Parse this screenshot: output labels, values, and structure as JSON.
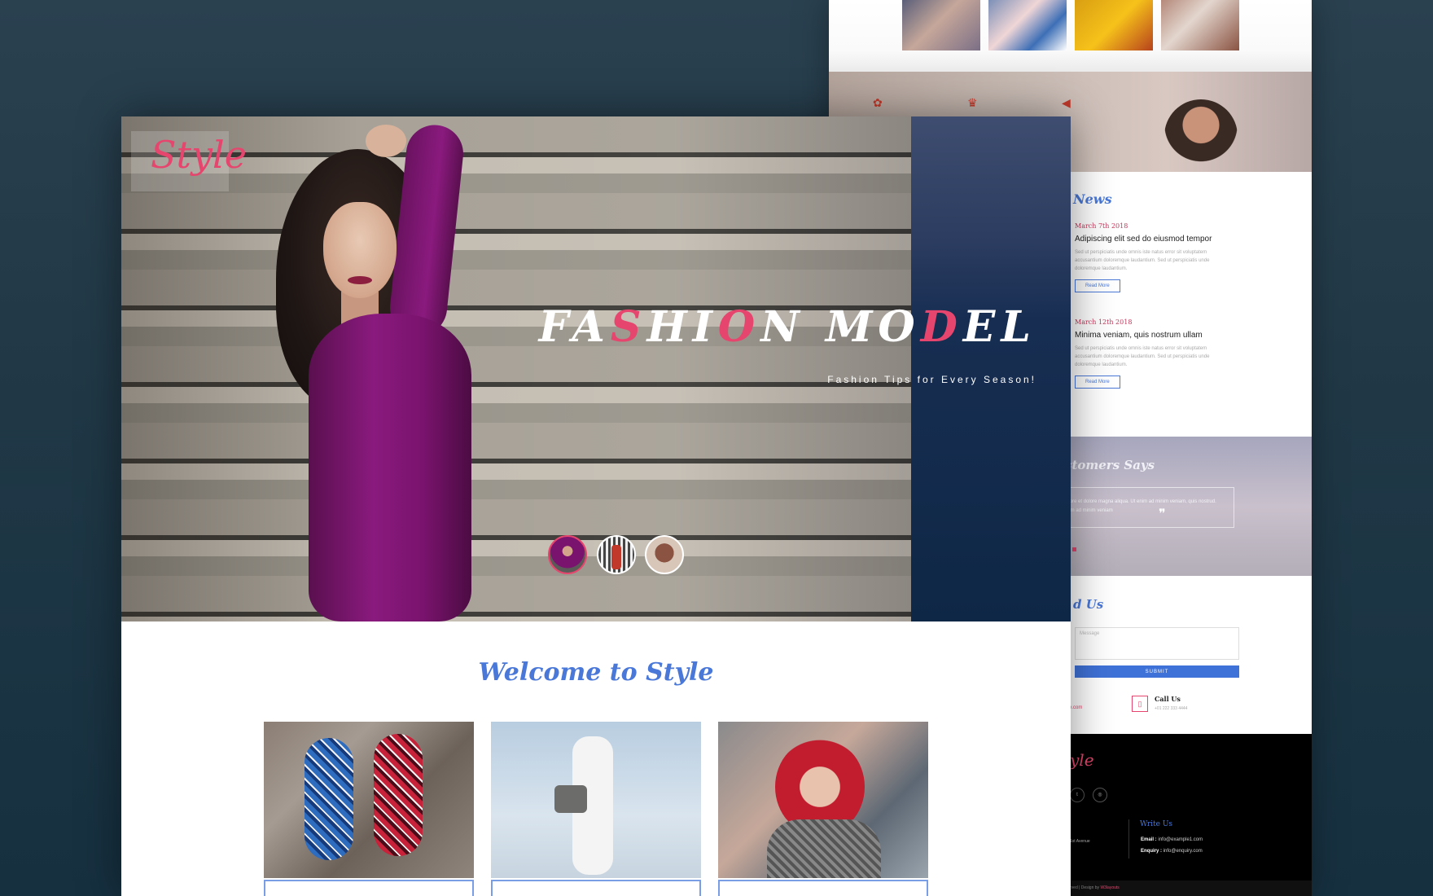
{
  "back_page": {
    "news": {
      "title_fragment": "News",
      "items": [
        {
          "date": "March 7th 2018",
          "headline": "Adipiscing elit sed do eiusmod tempor",
          "text": "Sed ut perspiciatis unde omnis iste natus error sit voluptatem accusantium doloremque laudantium. Sed ut perspiciatis unde doloremque laudantium.",
          "button": "Read More"
        },
        {
          "date": "March 12th 2018",
          "headline": "Minima veniam, quis nostrum ullam",
          "text": "Sed ut perspiciatis unde omnis iste natus error sit voluptatem accusantium doloremque laudantium. Sed ut perspiciatis unde doloremque laudantium.",
          "button": "Read More"
        }
      ]
    },
    "testimonials": {
      "title_fragment": "stomers Says",
      "text_fragment": "ut labore et dolore magna aliqua. Ut enim ad minim veniam, quis nostrud. Ut enim ad minim veniam",
      "quote": "❞"
    },
    "contact": {
      "title_fragment": "d Us",
      "message_placeholder": "Message",
      "submit_label": "SUBMIT",
      "email_fragment": "e.com",
      "call_heading": "Call Us",
      "call_number": "+01 222 333 4444"
    },
    "footer": {
      "logo_fragment": "yle",
      "address_fragment": "1st Avenue",
      "write_heading": "Write Us",
      "email_label": "Email :",
      "email_value": "info@example1.com",
      "enquiry_label": "Enquiry :",
      "enquiry_value": "info@enquiry.com",
      "copyright_fragment": "rved | Design by",
      "designer": "W3layouts"
    }
  },
  "front_page": {
    "logo": "Style",
    "hero": {
      "title_parts": [
        "FA",
        "S",
        "HI",
        "O",
        "N MO",
        "D",
        "EL"
      ],
      "subtitle": "Fashion Tips for Every Season!"
    },
    "welcome_title": "Welcome to Style"
  },
  "colors": {
    "accent_pink": "#e6456e",
    "accent_blue": "#4a78d8",
    "background": "#203846"
  }
}
